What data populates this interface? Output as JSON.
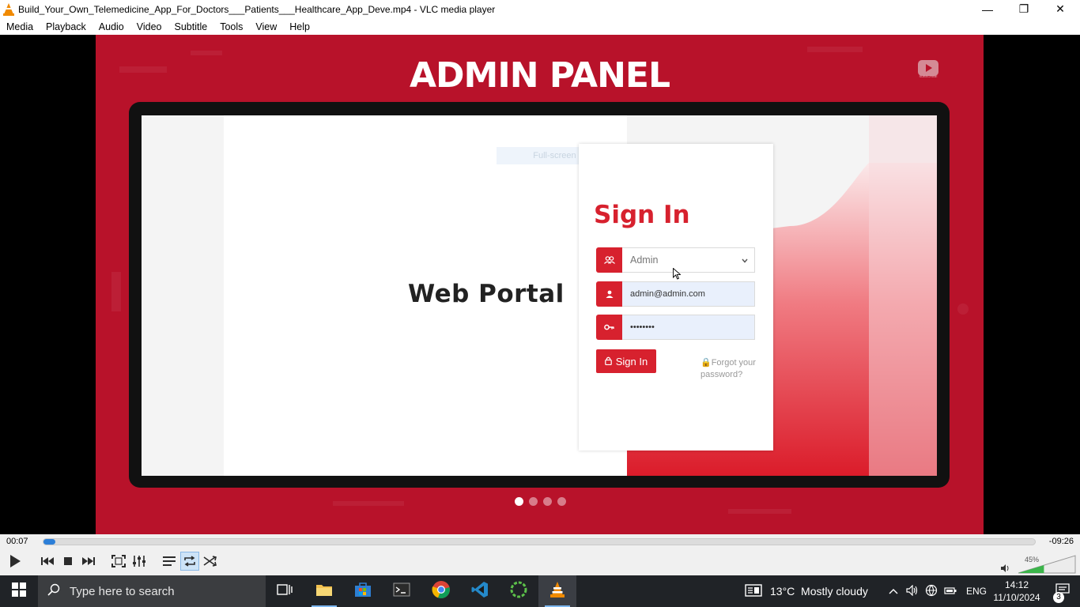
{
  "window": {
    "title": "Build_Your_Own_Telemedicine_App_For_Doctors___Patients___Healthcare_App_Deve.mp4 - VLC media player",
    "minimize_glyph": "—",
    "restore_glyph": "❐",
    "close_glyph": "✕"
  },
  "menu": {
    "items": [
      "Media",
      "Playback",
      "Audio",
      "Video",
      "Subtitle",
      "Tools",
      "View",
      "Help"
    ]
  },
  "video": {
    "heading": "ADMIN PANEL",
    "web_portal": "Web Portal",
    "fullscreen_hint": "Full-screen Snip",
    "signin_title": "Sign In",
    "role_value": "Admin",
    "email_value": "admin@admin.com",
    "password_value": "••••••••",
    "signin_button": "Sign In",
    "forgot_line1": "Forgot your",
    "forgot_line2": "password?",
    "slide_count": 4,
    "active_slide": 1,
    "accent_color": "#d7212e",
    "background_color": "#b8122a"
  },
  "controls": {
    "time_elapsed": "00:07",
    "time_remaining": "-09:26",
    "progress_fraction": 0.012,
    "volume_percent": "45%",
    "volume_level": 0.45,
    "icons": [
      "play-icon",
      "previous-icon",
      "stop-icon",
      "next-icon",
      "fullscreen-icon",
      "extended-settings-icon",
      "playlist-icon",
      "loop-icon",
      "shuffle-icon",
      "volume-icon"
    ]
  },
  "taskbar": {
    "search_placeholder": "Type here to search",
    "weather": "13°C  Mostly cloudy",
    "language": "ENG",
    "time": "14:12",
    "date": "11/10/2024",
    "notification_count": "3"
  }
}
